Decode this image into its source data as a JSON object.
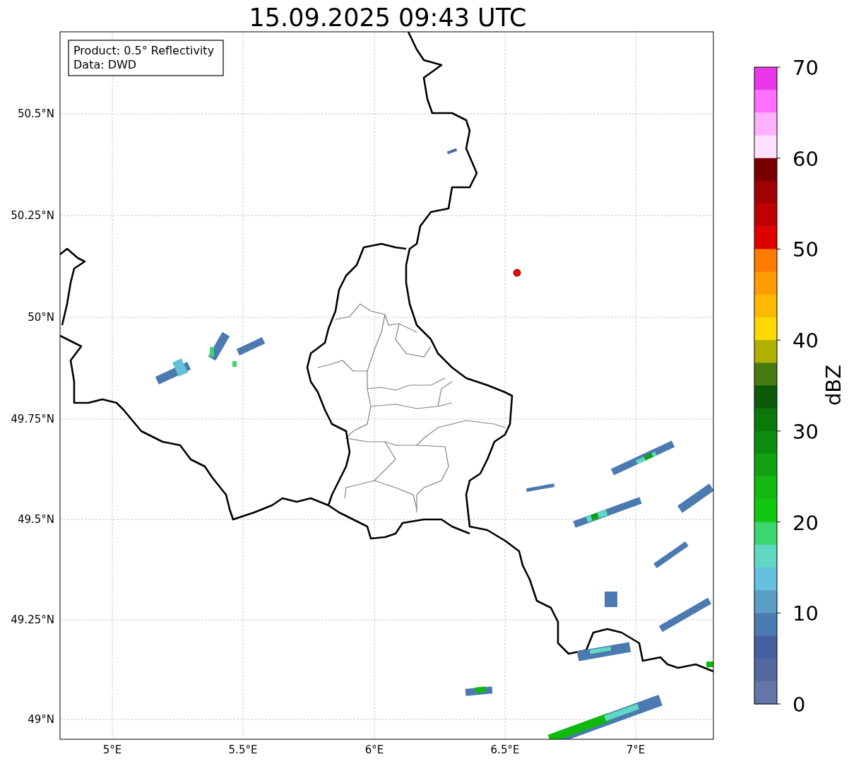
{
  "title": "15.09.2025 09:43 UTC",
  "legend": [
    "Product: 0.5° Reflectivity",
    "Data: DWD"
  ],
  "x_ticks": [
    "5°E",
    "5.5°E",
    "6°E",
    "6.5°E",
    "7°E"
  ],
  "y_ticks": [
    "50.5°N",
    "50.25°N",
    "50°N",
    "49.75°N",
    "49.5°N",
    "49.25°N",
    "49°N"
  ],
  "colorbar": {
    "label": "dBZ",
    "ticks": [
      "70",
      "60",
      "50",
      "40",
      "30",
      "20",
      "10",
      "0"
    ],
    "segments": [
      {
        "color": "#e838e8"
      },
      {
        "color": "#ff70ff"
      },
      {
        "color": "#ffb0ff"
      },
      {
        "color": "#ffe0ff"
      },
      {
        "color": "#7a0000"
      },
      {
        "color": "#a00000"
      },
      {
        "color": "#c00000"
      },
      {
        "color": "#e00000"
      },
      {
        "color": "#ff7c00"
      },
      {
        "color": "#ff9c00"
      },
      {
        "color": "#ffb800"
      },
      {
        "color": "#ffd800"
      },
      {
        "color": "#b0b000"
      },
      {
        "color": "#487810"
      },
      {
        "color": "#0a5a0a"
      },
      {
        "color": "#0a780a"
      },
      {
        "color": "#0c8c0c"
      },
      {
        "color": "#10a010"
      },
      {
        "color": "#10b810"
      },
      {
        "color": "#10c810"
      },
      {
        "color": "#3cd670"
      },
      {
        "color": "#60d8c4"
      },
      {
        "color": "#64c0dc"
      },
      {
        "color": "#5a9ec8"
      },
      {
        "color": "#4a7ab0"
      },
      {
        "color": "#4460a0"
      },
      {
        "color": "#5468a0"
      },
      {
        "color": "#6476a8"
      }
    ]
  }
}
